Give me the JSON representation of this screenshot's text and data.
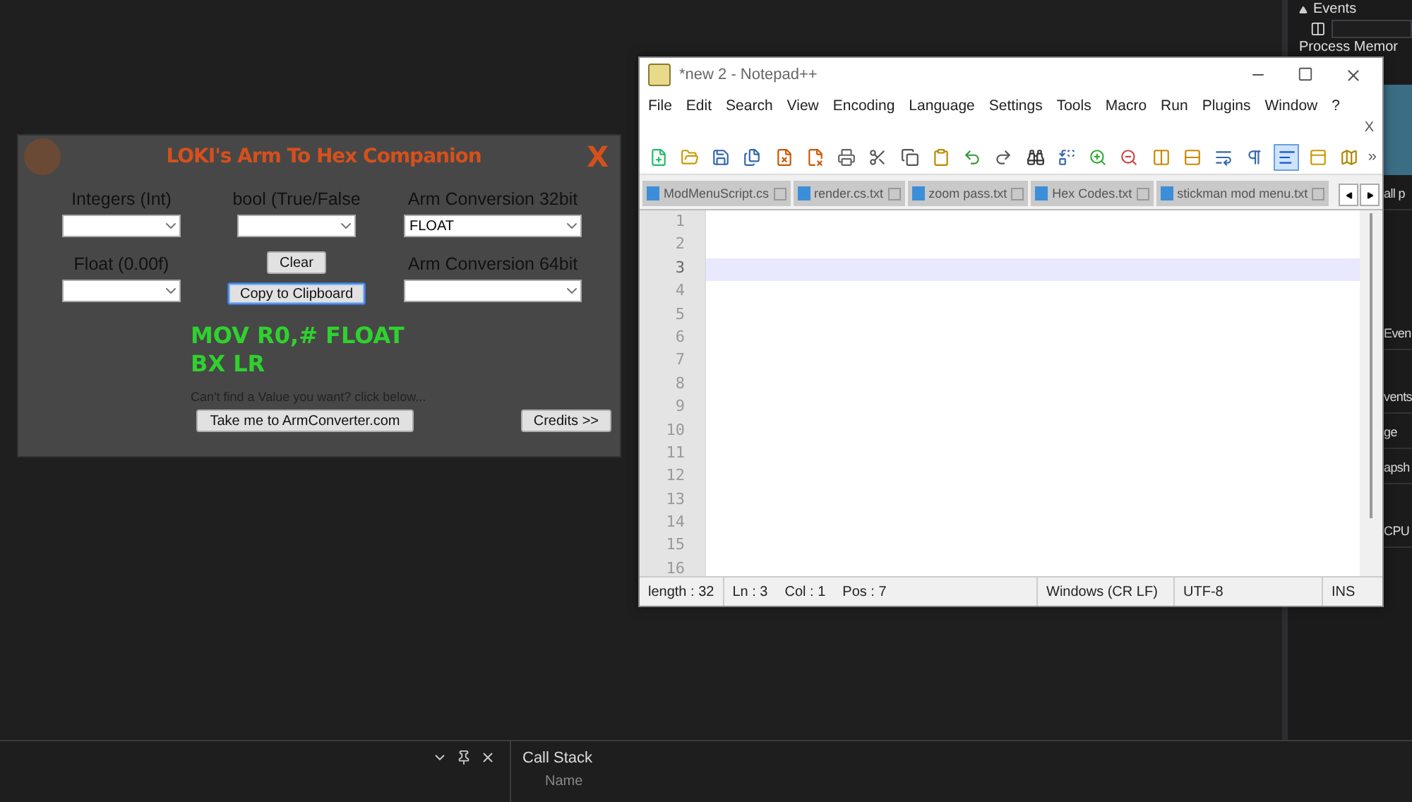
{
  "ide": {
    "right_panel": {
      "header": "Events",
      "section": "Process Memor",
      "rows": [
        "all p",
        "Even",
        "vents",
        "ge",
        "apsh",
        "CPU"
      ]
    },
    "bottom_panel": {
      "title": "Call Stack",
      "column": "Name"
    }
  },
  "companion": {
    "title": "LOKI's Arm To Hex Companion",
    "close": "X",
    "fields": [
      {
        "label": "Integers (Int)"
      },
      {
        "label": "bool (True/False"
      },
      {
        "label": "Arm Conversion 32bit",
        "value": "FLOAT"
      },
      {
        "label": "Float (0.00f)"
      },
      {
        "label": "Arm Conversion 64bit"
      }
    ],
    "clear": "Clear",
    "copy": {
      "label": "Copy to Clipboard",
      "focused": true
    },
    "output": [
      "MOV R0,# FLOAT",
      "BX LR"
    ],
    "hint": "Can't find a Value you want? click below...",
    "link": "Take me to ArmConverter.com",
    "credits": "Credits >>"
  },
  "notepad": {
    "title": "*new 2 - Notepad++",
    "menu": [
      "File",
      "Edit",
      "Search",
      "View",
      "Encoding",
      "Language",
      "Settings",
      "Tools",
      "Macro",
      "Run",
      "Plugins",
      "Window",
      "?"
    ],
    "doc_close": "X",
    "more": "»",
    "toolbar": [
      {
        "kind": "new",
        "on": false
      },
      {
        "kind": "open",
        "on": false
      },
      {
        "kind": "save",
        "on": false
      },
      {
        "kind": "saveall",
        "on": false
      },
      {
        "kind": "close",
        "on": false
      },
      {
        "kind": "closeall",
        "on": false
      },
      {
        "kind": "print",
        "on": false
      },
      {
        "kind": "cut",
        "on": false
      },
      {
        "kind": "copy",
        "on": false
      },
      {
        "kind": "paste",
        "on": false
      },
      {
        "kind": "undo",
        "on": false
      },
      {
        "kind": "redo",
        "on": false
      },
      {
        "kind": "find",
        "on": false
      },
      {
        "kind": "replace",
        "on": false
      },
      {
        "kind": "zoomin",
        "on": false
      },
      {
        "kind": "zoomout",
        "on": false
      },
      {
        "kind": "sync",
        "on": false
      },
      {
        "kind": "syncv",
        "on": false
      },
      {
        "kind": "wrap",
        "on": false
      },
      {
        "kind": "allchars",
        "on": false
      },
      {
        "kind": "indent",
        "on": true
      },
      {
        "kind": "panel",
        "on": false
      },
      {
        "kind": "map",
        "on": false
      }
    ],
    "tabs": [
      {
        "label": "ModMenuScript.cs",
        "selected": false
      },
      {
        "label": "render.cs.txt",
        "selected": false
      },
      {
        "label": "zoom pass.txt",
        "selected": false
      },
      {
        "label": "Hex Codes.txt",
        "selected": false
      },
      {
        "label": "stickman mod menu.txt",
        "selected": false
      }
    ],
    "lines": [
      {
        "number": "1",
        "current": false
      },
      {
        "number": "2",
        "current": false
      },
      {
        "number": "3",
        "current": true
      },
      {
        "number": "4",
        "current": false
      },
      {
        "number": "5",
        "current": false
      },
      {
        "number": "6",
        "current": false
      },
      {
        "number": "7",
        "current": false
      },
      {
        "number": "8",
        "current": false
      },
      {
        "number": "9",
        "current": false
      },
      {
        "number": "10",
        "current": false
      },
      {
        "number": "11",
        "current": false
      },
      {
        "number": "12",
        "current": false
      },
      {
        "number": "13",
        "current": false
      },
      {
        "number": "14",
        "current": false
      },
      {
        "number": "15",
        "current": false
      },
      {
        "number": "16",
        "current": false
      }
    ],
    "status": [
      "length : 32",
      "Ln : 3",
      "Col : 1",
      "Pos : 7",
      "Windows (CR LF)",
      "UTF-8",
      "INS"
    ]
  }
}
